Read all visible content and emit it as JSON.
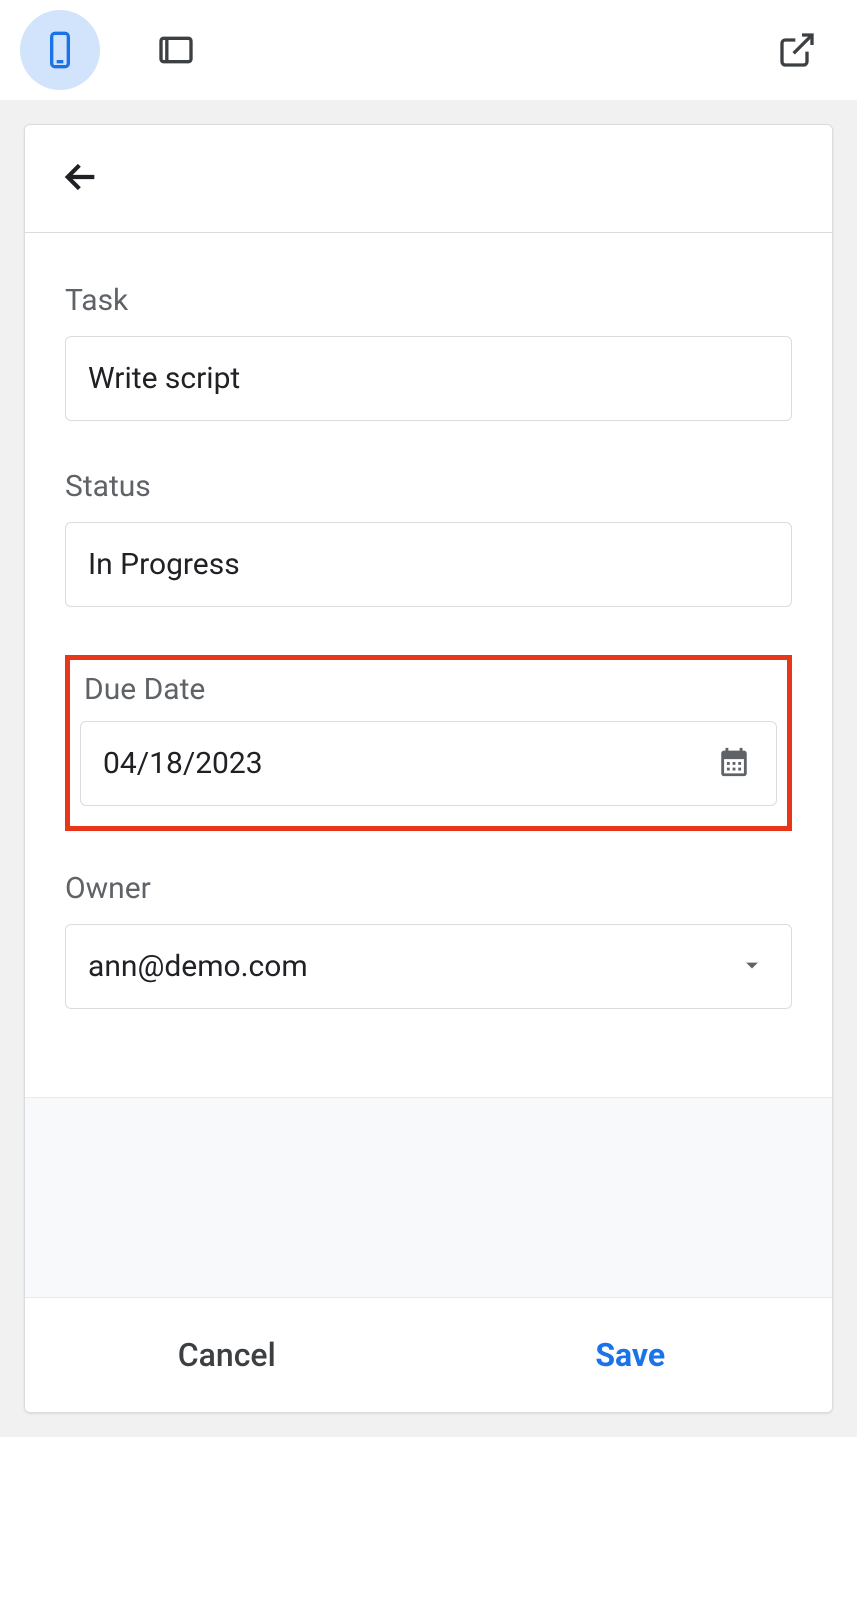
{
  "toolbar": {
    "mobile_icon": "phone-icon",
    "tablet_icon": "tablet-icon",
    "external_icon": "open-external-icon"
  },
  "form": {
    "fields": {
      "task": {
        "label": "Task",
        "value": "Write script"
      },
      "status": {
        "label": "Status",
        "value": "In Progress"
      },
      "due_date": {
        "label": "Due Date",
        "value": "04/18/2023"
      },
      "owner": {
        "label": "Owner",
        "value": "ann@demo.com"
      }
    }
  },
  "footer": {
    "cancel": "Cancel",
    "save": "Save"
  }
}
